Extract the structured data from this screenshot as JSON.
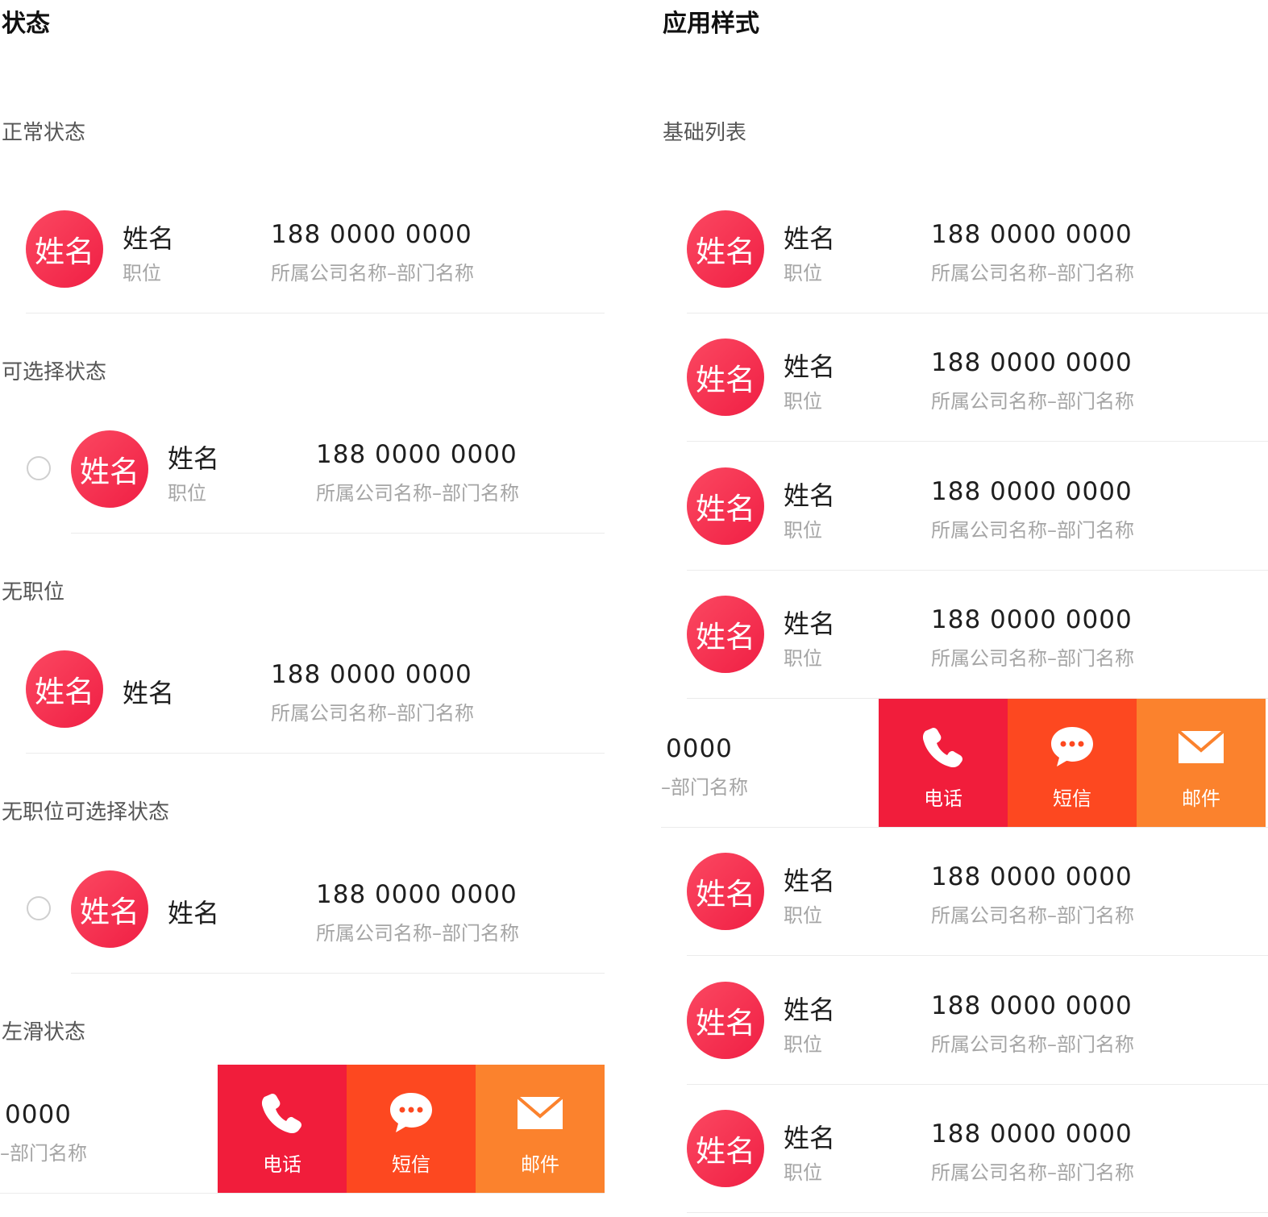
{
  "left": {
    "title": "状态",
    "sections": {
      "normal": "正常状态",
      "selectable": "可选择状态",
      "no_position": "无职位",
      "no_position_selectable": "无职位可选择状态",
      "swipe_left": "左滑状态"
    }
  },
  "right": {
    "title": "应用样式",
    "section": "基础列表"
  },
  "contact": {
    "avatar_text": "姓名",
    "name": "姓名",
    "position": "职位",
    "phone": "188 0000 0000",
    "company": "所属公司名称–部门名称"
  },
  "swiped": {
    "phone_fragment": "0000",
    "company_fragment": "–部门名称"
  },
  "actions": {
    "call": "电话",
    "sms": "短信",
    "mail": "邮件"
  },
  "colors": {
    "avatar": "#f01f44",
    "call": "#f11d3b",
    "sms": "#fd4820",
    "mail": "#fb822d"
  }
}
